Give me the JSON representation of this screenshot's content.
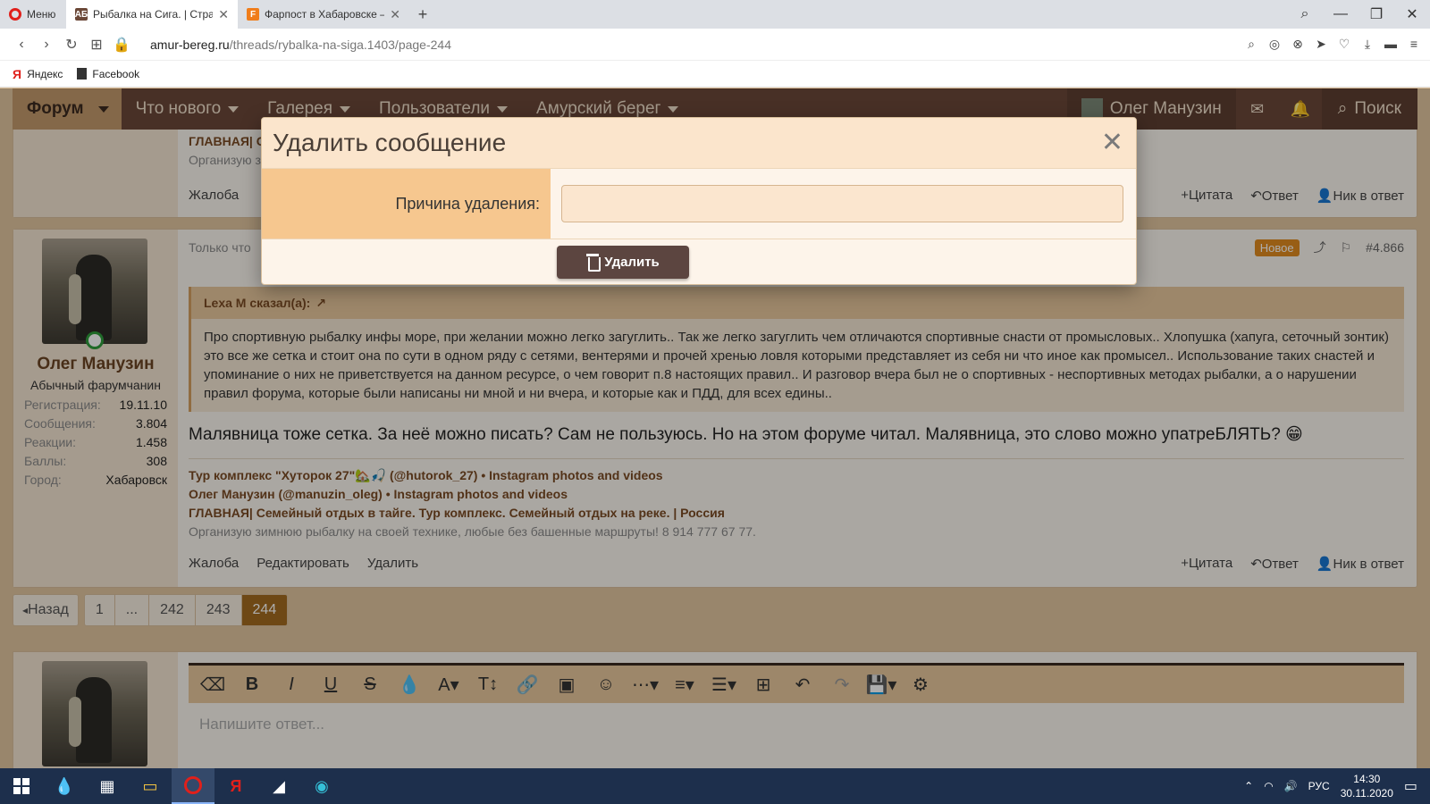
{
  "browser": {
    "menu_label": "Меню",
    "tabs": [
      {
        "label": "Рыбалка на Сига. | Страни",
        "favicon_text": "АБ",
        "favicon_color": "#6b4838"
      },
      {
        "label": "Фарпост в Хабаровске —",
        "favicon_text": "F",
        "favicon_color": "#f07d1a"
      }
    ],
    "url_host": "amur-bereg.ru",
    "url_path": "/threads/rybalka-na-siga.1403/page-244",
    "bookmarks": [
      {
        "label": "Яндекс"
      },
      {
        "label": "Facebook"
      }
    ]
  },
  "nav": {
    "forum": "Форум",
    "items": [
      "Что нового",
      "Галерея",
      "Пользователи",
      "Амурский берег"
    ],
    "user": "Олег Манузин",
    "search": "Поиск"
  },
  "post_prev": {
    "sig_link": "ГЛАВНАЯ| С",
    "sig_text": "Организую з",
    "action_report": "Жалоба",
    "actions_right": [
      "+Цитата",
      "Ответ",
      "Ник в ответ"
    ]
  },
  "post": {
    "time": "Только что",
    "badge": "Новое",
    "number": "#4.866",
    "author": {
      "name": "Олег Манузин",
      "title": "Абычный фарумчанин",
      "stats": [
        {
          "k": "Регистрация:",
          "v": "19.11.10"
        },
        {
          "k": "Сообщения:",
          "v": "3.804"
        },
        {
          "k": "Реакции:",
          "v": "1.458"
        },
        {
          "k": "Баллы:",
          "v": "308"
        },
        {
          "k": "Город:",
          "v": "Хабаровск"
        }
      ]
    },
    "quote_author": "Lexa M сказал(а):",
    "quote_text": "Про спортивную рыбалку инфы море, при желании можно легко загуглить.. Так же легко загуглить чем отличаются спортивные снасти от промысловых.. Хлопушка (хапуга, сеточный зонтик) это все же сетка и стоит она по сути в одном ряду с сетями, вентерями и прочей хренью ловля которыми представляет из себя ни что иное как промысел.. Использование таких снастей и упоминание о них не приветствуется на данном ресурсе, о чем говорит п.8 настоящих правил.. И разговор вчера был не о спортивных - неспортивных методах рыбалки, а о нарушении правил форума, которые были написаны ни мной и ни вчера, и которые как и ПДД, для всех едины..",
    "message": "Малявница тоже сетка. За неё можно писать? Сам не пользуюсь. Но на этом форуме читал. Малявница, это слово можно упатреБЛЯТЬ? 😁",
    "signature": {
      "links": [
        "Тур комплекс \"Хуторок 27\"🏡🎣 (@hutorok_27) • Instagram photos and videos",
        "Олег Манузин (@manuzin_oleg) • Instagram photos and videos",
        "ГЛАВНАЯ| Семейный отдых в тайге. Тур комплекс. Семейный отдых на реке. | Россия"
      ],
      "text": "Организую зимнюю рыбалку на своей технике, любые без башенные маршруты! 8 914 777 67 77."
    },
    "actions_left": [
      "Жалоба",
      "Редактировать",
      "Удалить"
    ],
    "actions_right": [
      "+Цитата",
      "Ответ",
      "Ник в ответ"
    ]
  },
  "pager": {
    "prev": "Назад",
    "pages": [
      "1",
      "...",
      "242",
      "243",
      "244"
    ],
    "current": "244"
  },
  "editor": {
    "placeholder": "Напишите ответ..."
  },
  "modal": {
    "title": "Удалить сообщение",
    "reason_label": "Причина удаления:",
    "reason_value": "",
    "delete_label": "Удалить"
  },
  "taskbar": {
    "lang": "РУС",
    "time": "14:30",
    "date": "30.11.2020"
  },
  "colors": {
    "nav_bg": "#6b4838",
    "accent": "#a26a1f",
    "modal_label_bg": "#f6c78f",
    "delete_button": "#5c4540"
  }
}
